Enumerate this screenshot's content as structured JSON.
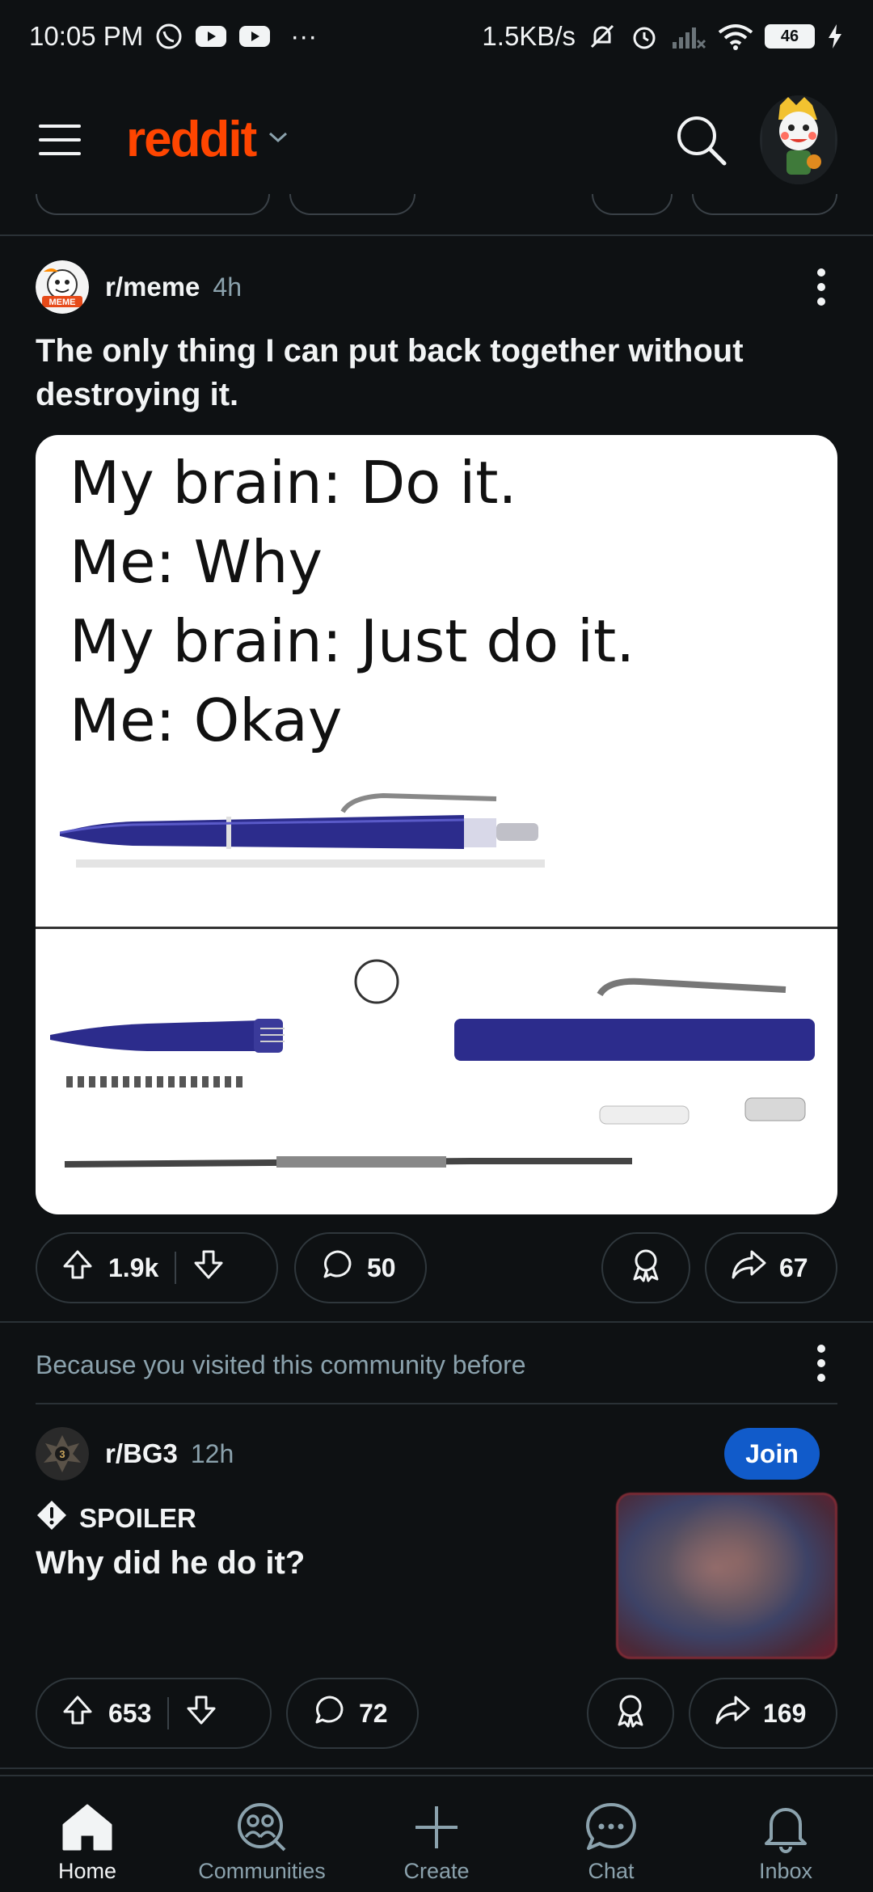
{
  "status_bar": {
    "time": "10:05 PM",
    "more": "···",
    "net_speed": "1.5KB/s",
    "battery": "46"
  },
  "header": {
    "logo": "reddit",
    "icons": [
      "menu-icon",
      "chevron-down-icon",
      "search-icon",
      "avatar"
    ]
  },
  "posts": [
    {
      "subreddit": "r/meme",
      "age": "4h",
      "title": "The only thing I can put back together without destroying it.",
      "image_lines": [
        "My brain: Do it.",
        "Me: Why",
        "My brain: Just do it.",
        "Me: Okay"
      ],
      "votes": "1.9k",
      "comments": "50",
      "shares": "67"
    },
    {
      "reason": "Because you visited this community before",
      "subreddit": "r/BG3",
      "age": "12h",
      "join_label": "Join",
      "spoiler_label": "SPOILER",
      "title": "Why did he do it?",
      "votes": "653",
      "comments": "72",
      "shares": "169"
    }
  ],
  "bottom_nav": [
    {
      "label": "Home",
      "icon": "home-icon",
      "active": true
    },
    {
      "label": "Communities",
      "icon": "communities-icon"
    },
    {
      "label": "Create",
      "icon": "plus-icon"
    },
    {
      "label": "Chat",
      "icon": "chat-icon"
    },
    {
      "label": "Inbox",
      "icon": "bell-icon"
    }
  ],
  "colors": {
    "background": "#0e1113",
    "brand": "#ff4500",
    "join": "#115bca",
    "muted": "#8ba2ad"
  }
}
